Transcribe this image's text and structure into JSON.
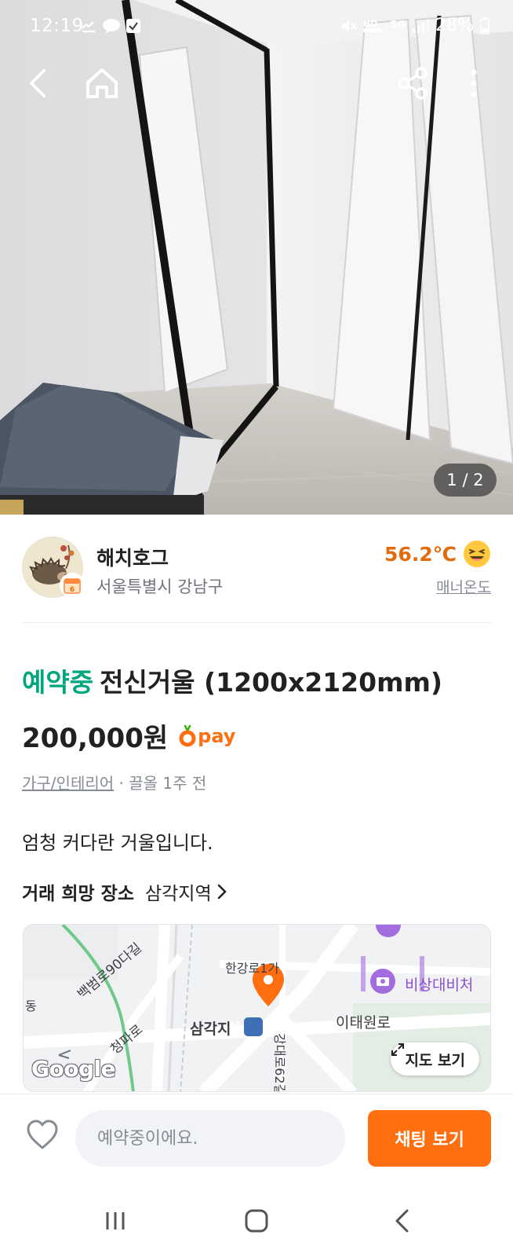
{
  "status_bar": {
    "time": "12:19",
    "battery": "28%",
    "network": "5G"
  },
  "top_nav": {
    "back_icon": "arrow-left-icon",
    "home_icon": "home-icon",
    "share_icon": "share-icon",
    "more_icon": "more-vertical-icon"
  },
  "gallery": {
    "counter": "1 / 2"
  },
  "seller": {
    "name": "해치호그",
    "region": "서울특별시 강남구",
    "manner_temp": "56.2℃",
    "manner_label": "매너온도",
    "temp_color": "#e06c0e"
  },
  "article": {
    "status": "예약중",
    "title": "전신거울 (1200x2120mm)",
    "price": "200,000원",
    "pay_label": "pay",
    "category": "가구/인테리어",
    "time_info": "· 끌올 1주 전",
    "description": "엄청 커다란 거울입니다.",
    "status_color": "#00a67e"
  },
  "place": {
    "label": "거래 희망 장소",
    "value": "삼각지역"
  },
  "map": {
    "labels": {
      "hangangro": "한강로1가",
      "itaewonro": "이태원로",
      "samgakji": "삼각지",
      "emergency": "비상대비처",
      "baekbeomro": "백범로90다길",
      "cheongparo": "청파로",
      "gangdaero": "강대로62길",
      "dong": "동",
      "metro_badge": "M"
    },
    "view_button": "지도 보기",
    "logo": "Google"
  },
  "bottom_bar": {
    "input_placeholder": "예약중이에요.",
    "chat_button": "채팅 보기",
    "accent_color": "#ff6f0f"
  }
}
